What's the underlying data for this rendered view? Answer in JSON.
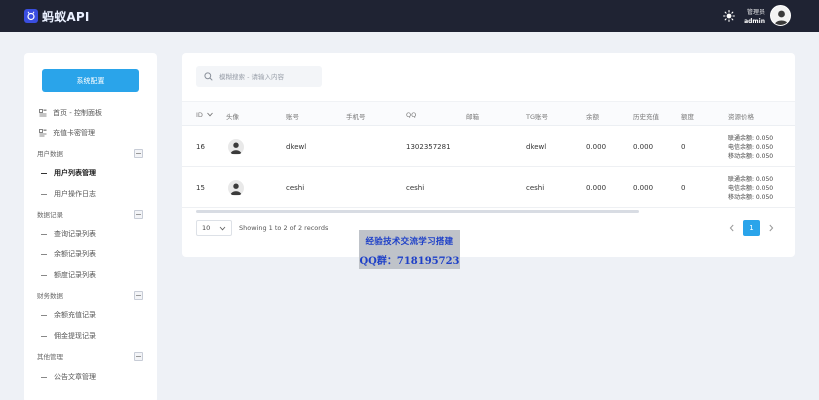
{
  "app": {
    "brand": "蚂蚁API",
    "user_role": "管理员",
    "user_name": "admin"
  },
  "sidebar": {
    "primary_button": "系统配置",
    "items": [
      {
        "kind": "item",
        "label": "首页 - 控制面板",
        "icon": "dashboard-icon"
      },
      {
        "kind": "item",
        "label": "充值卡密管理",
        "icon": "card-icon"
      },
      {
        "kind": "group",
        "label": "用户数据"
      },
      {
        "kind": "sub",
        "label": "用户列表管理",
        "active": true
      },
      {
        "kind": "sub",
        "label": "用户操作日志"
      },
      {
        "kind": "group",
        "label": "数据记录"
      },
      {
        "kind": "sub",
        "label": "查询记录列表"
      },
      {
        "kind": "sub",
        "label": "余额记录列表"
      },
      {
        "kind": "sub",
        "label": "额度记录列表"
      },
      {
        "kind": "group",
        "label": "财务数据"
      },
      {
        "kind": "sub",
        "label": "余额充值记录"
      },
      {
        "kind": "sub",
        "label": "佣金提现记录"
      },
      {
        "kind": "group",
        "label": "其他管理"
      },
      {
        "kind": "sub",
        "label": "公告文章管理"
      }
    ]
  },
  "search": {
    "placeholder": "模糊搜索 - 请输入内容"
  },
  "table": {
    "columns": [
      "ID",
      "头像",
      "账号",
      "手机号",
      "QQ",
      "邮箱",
      "TG账号",
      "余额",
      "历史充值",
      "额度",
      "资源价格"
    ],
    "rows": [
      {
        "id": "16",
        "account": "dkewl",
        "phone": "",
        "qq": "1302357281",
        "email": "",
        "tg": "dkewl",
        "balance": "0.000",
        "recharge": "0.000",
        "quota": "0",
        "rates": [
          "联通余额: 0.050",
          "电信余额: 0.050",
          "移动余额: 0.050"
        ]
      },
      {
        "id": "15",
        "account": "ceshi",
        "phone": "",
        "qq": "ceshi",
        "email": "",
        "tg": "ceshi",
        "balance": "0.000",
        "recharge": "0.000",
        "quota": "0",
        "rates": [
          "联通余额: 0.050",
          "电信余额: 0.050",
          "移动余额: 0.050"
        ]
      }
    ]
  },
  "pagination": {
    "page_size": "10",
    "records_text": "Showing 1 to 2 of 2 records",
    "current_page": "1"
  },
  "watermark": {
    "line1": "经验技术交流学习搭建",
    "line2": "QQ群：718195723"
  },
  "colors": {
    "topbar": "#1f2333",
    "accent": "#2aa4ea",
    "background": "#eef1f6"
  }
}
